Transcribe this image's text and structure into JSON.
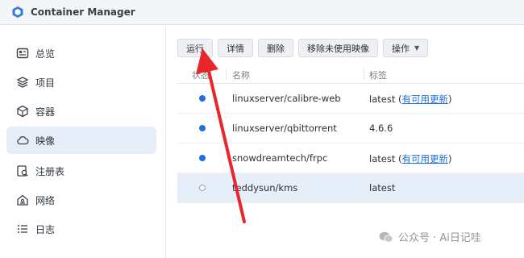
{
  "app": {
    "title": "Container Manager"
  },
  "sidebar": {
    "items": [
      {
        "label": "总览",
        "icon": "overview-icon"
      },
      {
        "label": "项目",
        "icon": "project-icon"
      },
      {
        "label": "容器",
        "icon": "container-icon"
      },
      {
        "label": "映像",
        "icon": "image-icon",
        "active": true
      },
      {
        "label": "注册表",
        "icon": "registry-icon"
      },
      {
        "label": "网络",
        "icon": "network-icon"
      },
      {
        "label": "日志",
        "icon": "log-icon"
      }
    ]
  },
  "toolbar": {
    "run": "运行",
    "details": "详情",
    "delete": "删除",
    "remove_unused": "移除未使用映像",
    "actions": "操作"
  },
  "table": {
    "headers": {
      "status": "状态",
      "name": "名称",
      "tag": "标签"
    },
    "rows": [
      {
        "status": "running",
        "name": "linuxserver/calibre-web",
        "tag": "latest",
        "update": "有可用更新"
      },
      {
        "status": "running",
        "name": "linuxserver/qbittorrent",
        "tag": "4.6.6",
        "update": ""
      },
      {
        "status": "running",
        "name": "snowdreamtech/frpc",
        "tag": "latest",
        "update": "有可用更新"
      },
      {
        "status": "stopped",
        "name": "teddysun/kms",
        "tag": "latest",
        "update": "",
        "selected": true
      }
    ]
  },
  "annotation": {
    "arrow_color": "#e8262b"
  },
  "watermark": {
    "text": "公众号 · Ai日记哇"
  },
  "colors": {
    "accent": "#1f6fe0",
    "link": "#1d6fd6",
    "selected_bg": "#e6eef9"
  }
}
